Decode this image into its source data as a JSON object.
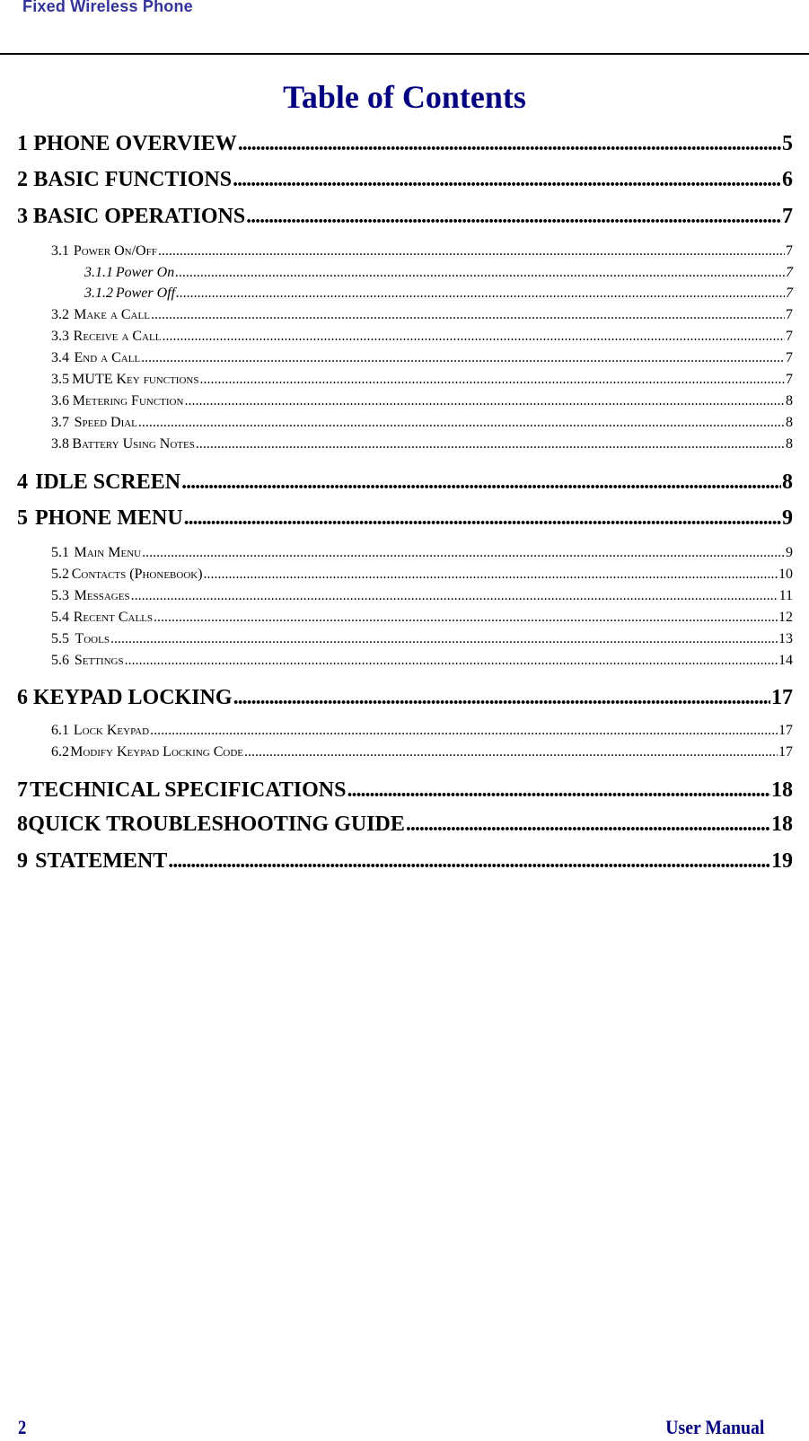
{
  "header": {
    "label": "Fixed Wireless Phone"
  },
  "title": "Table of Contents",
  "entries": [
    {
      "level": 1,
      "num": "1",
      "label": "PHONE OVERVIEW",
      "page": "5"
    },
    {
      "level": 1,
      "num": "2",
      "label": "BASIC FUNCTIONS",
      "page": "6"
    },
    {
      "level": 1,
      "num": "3",
      "label": "BASIC OPERATIONS",
      "page": "7"
    },
    {
      "level": 2,
      "num": "3.1",
      "label": "Power On/Off",
      "page": "7"
    },
    {
      "level": 3,
      "num": "3.1.1",
      "label": "Power On",
      "page": "7"
    },
    {
      "level": 3,
      "num": "3.1.2",
      "label": "Power Off",
      "page": "7"
    },
    {
      "level": 2,
      "num": "3.2",
      "label": "Make a Call",
      "page": "7"
    },
    {
      "level": 2,
      "num": "3.3",
      "label": "Receive a Call",
      "page": "7"
    },
    {
      "level": 2,
      "num": "3.4",
      "label": "End a Call",
      "page": "7"
    },
    {
      "level": 2,
      "num": "3.5",
      "label": "MUTE Key functions",
      "page": "7"
    },
    {
      "level": 2,
      "num": "3.6",
      "label": "Metering Function",
      "page": "8"
    },
    {
      "level": 2,
      "num": "3.7",
      "label": "Speed Dial",
      "page": "8"
    },
    {
      "level": 2,
      "num": "3.8",
      "label": "Battery Using Notes",
      "page": "8"
    },
    {
      "level": 1,
      "num": "4",
      "label": "IDLE SCREEN",
      "page": "8"
    },
    {
      "level": 1,
      "num": "5",
      "label": "PHONE MENU",
      "page": "9"
    },
    {
      "level": 2,
      "num": "5.1",
      "label": "Main Menu",
      "page": "9"
    },
    {
      "level": 2,
      "num": "5.2",
      "label": "Contacts (Phonebook)",
      "page": "10"
    },
    {
      "level": 2,
      "num": "5.3",
      "label": "Messages",
      "page": "11"
    },
    {
      "level": 2,
      "num": "5.4",
      "label": "Recent Calls",
      "page": "12"
    },
    {
      "level": 2,
      "num": "5.5",
      "label": "Tools",
      "page": "13"
    },
    {
      "level": 2,
      "num": "5.6",
      "label": "Settings",
      "page": "14"
    },
    {
      "level": 1,
      "num": "6",
      "label": "KEYPAD LOCKING",
      "page": "17"
    },
    {
      "level": 2,
      "num": "6.1",
      "label": "Lock Keypad",
      "page": "17"
    },
    {
      "level": 2,
      "num": "6.2",
      "label": "Modify Keypad Locking Code",
      "page": "17"
    },
    {
      "level": 1,
      "num": "7",
      "label": "TECHNICAL SPECIFICATIONS",
      "page": "18"
    },
    {
      "level": 1,
      "num": "8",
      "label": "QUICK TROUBLESHOOTING GUIDE",
      "page": "18"
    },
    {
      "level": 1,
      "num": "9",
      "label": "STATEMENT",
      "page": "19"
    }
  ],
  "footer": {
    "page_number": "2",
    "title": "User Manual"
  }
}
